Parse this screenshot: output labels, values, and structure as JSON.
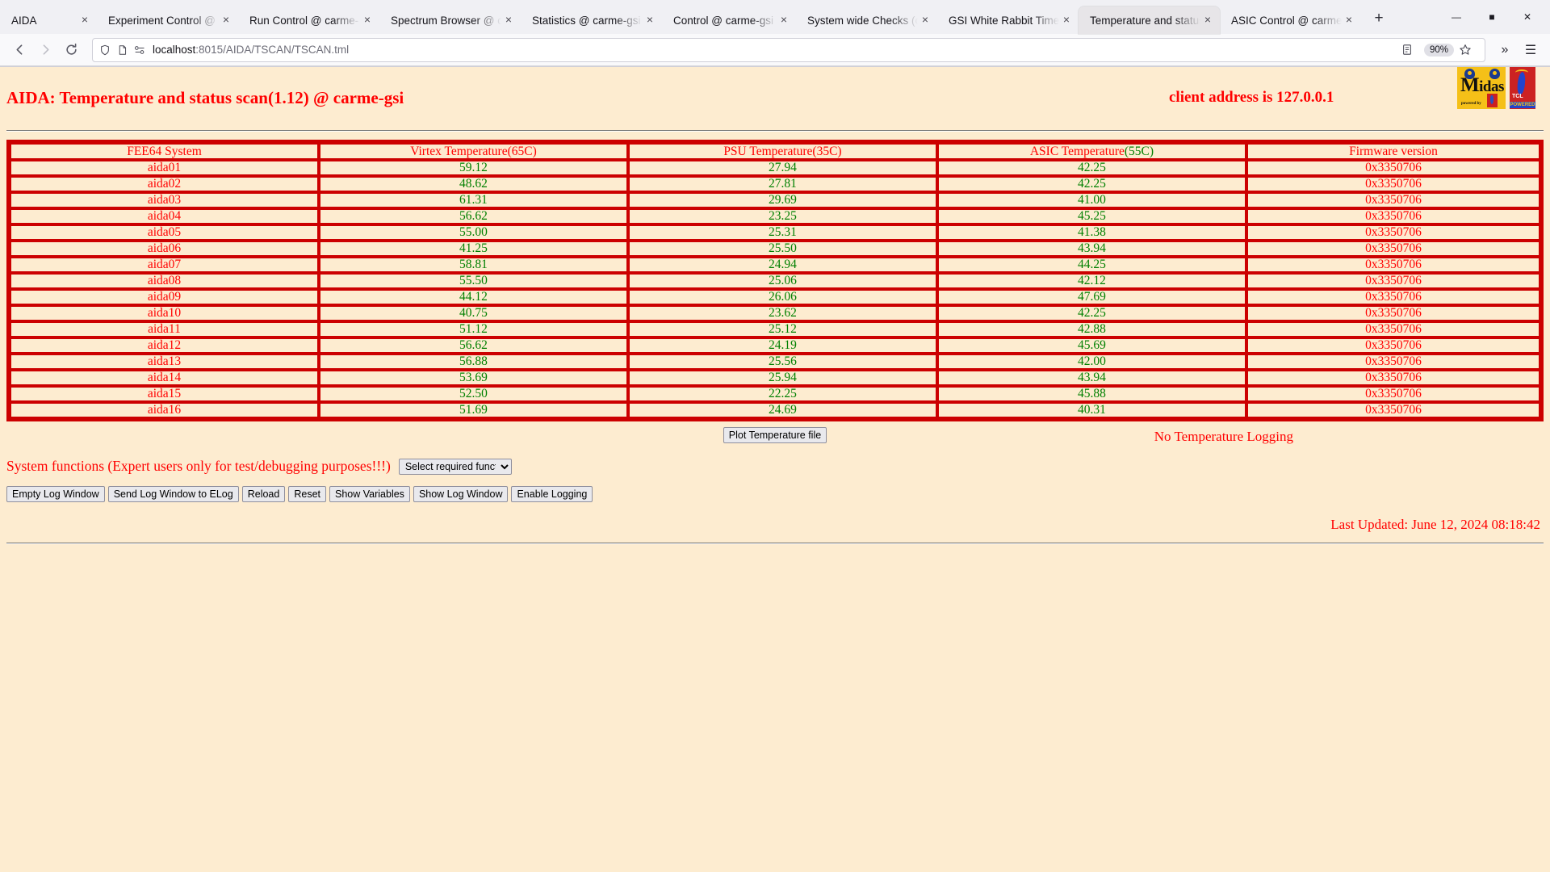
{
  "browser": {
    "tabs": [
      {
        "title": "AIDA",
        "active": false
      },
      {
        "title": "Experiment Control @ c",
        "active": false
      },
      {
        "title": "Run Control @ carme-",
        "active": false
      },
      {
        "title": "Spectrum Browser @ c",
        "active": false
      },
      {
        "title": "Statistics @ carme-gsi",
        "active": false
      },
      {
        "title": "Control @ carme-gsi",
        "active": false
      },
      {
        "title": "System wide Checks (c",
        "active": false
      },
      {
        "title": "GSI White Rabbit Time",
        "active": false
      },
      {
        "title": "Temperature and status",
        "active": true
      },
      {
        "title": "ASIC Control @ carme-",
        "active": false
      }
    ],
    "close_glyph": "×",
    "new_tab_label": "+",
    "window_controls": {
      "minimize": "—",
      "maximize": "■",
      "close": "✕"
    },
    "nav": {
      "back": "←",
      "forward": "→",
      "reload": "↻"
    },
    "url_host": "localhost",
    "url_rest": ":8015/AIDA/TSCAN/TSCAN.tml",
    "zoom_level": "90%",
    "overflow_label": "»",
    "menu_label": "☰"
  },
  "header": {
    "title": "AIDA: Temperature and status scan(1.12) @ carme-gsi",
    "client_address": "client address is 127.0.0.1",
    "logo_midas_word_first": "M",
    "logo_midas_word_rest": "idas",
    "logo_midas_powered": "powered by",
    "logo_tcl_word": "TCL",
    "logo_tcl_powered": "POWERED"
  },
  "table": {
    "columns": [
      "FEE64 System",
      "Virtex Temperature(65C)",
      "PSU Temperature(35C)",
      "ASIC Temperature(55C)",
      "Firmware version"
    ],
    "rows": [
      {
        "system": "aida01",
        "virtex": "59.12",
        "psu": "27.94",
        "asic": "42.25",
        "firmware": "0x3350706"
      },
      {
        "system": "aida02",
        "virtex": "48.62",
        "psu": "27.81",
        "asic": "42.25",
        "firmware": "0x3350706"
      },
      {
        "system": "aida03",
        "virtex": "61.31",
        "psu": "29.69",
        "asic": "41.00",
        "firmware": "0x3350706"
      },
      {
        "system": "aida04",
        "virtex": "56.62",
        "psu": "23.25",
        "asic": "45.25",
        "firmware": "0x3350706"
      },
      {
        "system": "aida05",
        "virtex": "55.00",
        "psu": "25.31",
        "asic": "41.38",
        "firmware": "0x3350706"
      },
      {
        "system": "aida06",
        "virtex": "41.25",
        "psu": "25.50",
        "asic": "43.94",
        "firmware": "0x3350706"
      },
      {
        "system": "aida07",
        "virtex": "58.81",
        "psu": "24.94",
        "asic": "44.25",
        "firmware": "0x3350706"
      },
      {
        "system": "aida08",
        "virtex": "55.50",
        "psu": "25.06",
        "asic": "42.12",
        "firmware": "0x3350706"
      },
      {
        "system": "aida09",
        "virtex": "44.12",
        "psu": "26.06",
        "asic": "47.69",
        "firmware": "0x3350706"
      },
      {
        "system": "aida10",
        "virtex": "40.75",
        "psu": "23.62",
        "asic": "42.25",
        "firmware": "0x3350706"
      },
      {
        "system": "aida11",
        "virtex": "51.12",
        "psu": "25.12",
        "asic": "42.88",
        "firmware": "0x3350706"
      },
      {
        "system": "aida12",
        "virtex": "56.62",
        "psu": "24.19",
        "asic": "45.69",
        "firmware": "0x3350706"
      },
      {
        "system": "aida13",
        "virtex": "56.88",
        "psu": "25.56",
        "asic": "42.00",
        "firmware": "0x3350706"
      },
      {
        "system": "aida14",
        "virtex": "53.69",
        "psu": "25.94",
        "asic": "43.94",
        "firmware": "0x3350706"
      },
      {
        "system": "aida15",
        "virtex": "52.50",
        "psu": "22.25",
        "asic": "45.88",
        "firmware": "0x3350706"
      },
      {
        "system": "aida16",
        "virtex": "51.69",
        "psu": "24.69",
        "asic": "40.31",
        "firmware": "0x3350706"
      }
    ]
  },
  "controls": {
    "plot_button": "Plot Temperature file",
    "logging_status": "No Temperature Logging",
    "sysfunc_label": "System functions (Expert users only for test/debugging purposes!!!)",
    "sysfunc_selected": "Select required function",
    "buttons": [
      "Empty Log Window",
      "Send Log Window to ELog",
      "Reload",
      "Reset",
      "Show Variables",
      "Show Log Window",
      "Enable Logging"
    ]
  },
  "footer": {
    "last_updated": "Last Updated: June 12, 2024 08:18:42"
  },
  "colors": {
    "page_background": "#fdecd0",
    "label_red": "#ff0000",
    "value_green": "#008000",
    "border_red": "#cc0000"
  }
}
